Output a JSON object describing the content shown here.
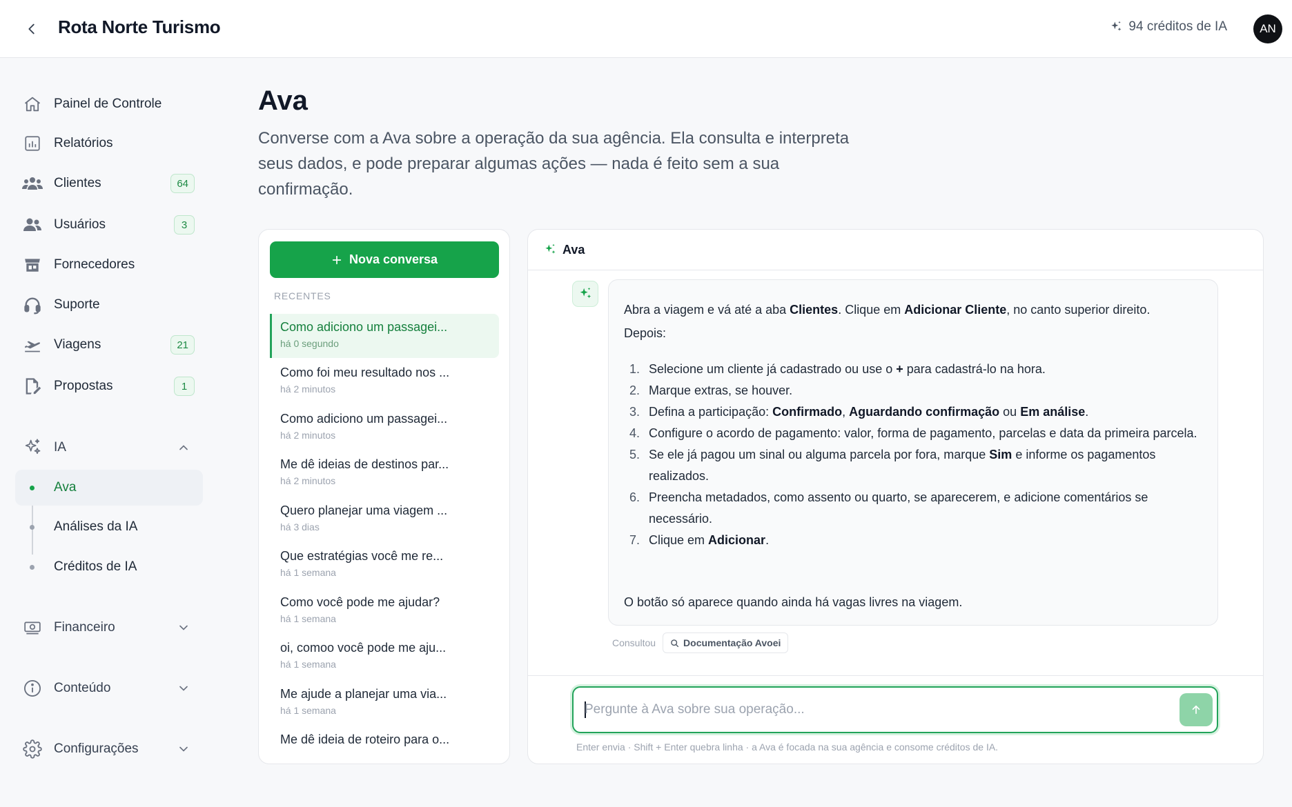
{
  "header": {
    "title": "Rota Norte Turismo",
    "credits": "94 créditos de IA",
    "avatar_initials": "AN"
  },
  "sidebar": {
    "items": [
      {
        "label": "Painel de Controle",
        "icon": "home-icon"
      },
      {
        "label": "Relatórios",
        "icon": "report-icon"
      },
      {
        "label": "Clientes",
        "icon": "users-group-icon",
        "badge": "64"
      },
      {
        "label": "Usuários",
        "icon": "users-icon",
        "badge": "3"
      },
      {
        "label": "Fornecedores",
        "icon": "store-icon"
      },
      {
        "label": "Suporte",
        "icon": "headset-icon"
      },
      {
        "label": "Viagens",
        "icon": "plane-icon",
        "badge": "21"
      },
      {
        "label": "Propostas",
        "icon": "document-edit-icon",
        "badge": "1"
      }
    ],
    "ia_section": {
      "label": "IA",
      "sub_items": [
        "Ava",
        "Análises da IA",
        "Créditos de IA"
      ],
      "active": "Ava"
    },
    "financeiro": "Financeiro",
    "conteudo": "Conteúdo",
    "configuracoes": "Configurações"
  },
  "page": {
    "title": "Ava",
    "description": "Converse com a Ava sobre a operação da sua agência. Ela consulta e interpreta seus dados, e pode preparar algumas ações — nada é feito sem a sua confirmação."
  },
  "conversations": {
    "new_button": "Nova conversa",
    "recent_label": "RECENTES",
    "items": [
      {
        "title": "Como adiciono um passagei...",
        "time": "há 0 segundo",
        "active": true
      },
      {
        "title": "Como foi meu resultado nos ...",
        "time": "há 2 minutos"
      },
      {
        "title": "Como adiciono um passagei...",
        "time": "há 2 minutos"
      },
      {
        "title": "Me dê ideias de destinos par...",
        "time": "há 2 minutos"
      },
      {
        "title": "Quero planejar uma viagem ...",
        "time": "há 3 dias"
      },
      {
        "title": "Que estratégias você me re...",
        "time": "há 1 semana"
      },
      {
        "title": "Como você pode me ajudar?",
        "time": "há 1 semana"
      },
      {
        "title": "oi, comoo você pode me aju...",
        "time": "há 1 semana"
      },
      {
        "title": "Me ajude a planejar uma via...",
        "time": "há 1 semana"
      },
      {
        "title": "Me dê ideia de roteiro para o...",
        "time": ""
      }
    ]
  },
  "chat": {
    "assistant_name": "Ava",
    "message": {
      "p1_a": "Abra a viagem e vá até a aba ",
      "p1_b": "Clientes",
      "p1_c": ". Clique em ",
      "p1_d": "Adicionar Cliente",
      "p1_e": ", no canto superior direito.",
      "p2": "Depois:",
      "steps": [
        [
          "Selecione um cliente já cadastrado ou use o ",
          "+",
          " para cadastrá-lo na hora."
        ],
        [
          "Marque extras, se houver."
        ],
        [
          "Defina a participação: ",
          "Confirmado",
          ", ",
          "Aguardando confirmação",
          " ou ",
          "Em análise",
          "."
        ],
        [
          "Configure o acordo de pagamento: valor, forma de pagamento, parcelas e data da primeira parcela."
        ],
        [
          "Se ele já pagou um sinal ou alguma parcela por fora, marque ",
          "Sim",
          " e informe os pagamentos realizados."
        ],
        [
          "Preencha metadados, como assento ou quarto, se aparecerem, e adicione comentários se necessário."
        ],
        [
          "Clique em ",
          "Adicionar",
          "."
        ]
      ],
      "p3": "O botão só aparece quando ainda há vagas livres na viagem."
    },
    "consulted_label": "Consultou",
    "source": "Documentação Avoei",
    "input_placeholder": "Pergunte à Ava sobre sua operação...",
    "hint": "Enter envia · Shift + Enter quebra linha · a Ava é focada na sua agência e consome créditos de IA."
  },
  "colors": {
    "accent": "#16a34a",
    "accent_light": "#ecf8f0",
    "text": "#1f2937"
  }
}
